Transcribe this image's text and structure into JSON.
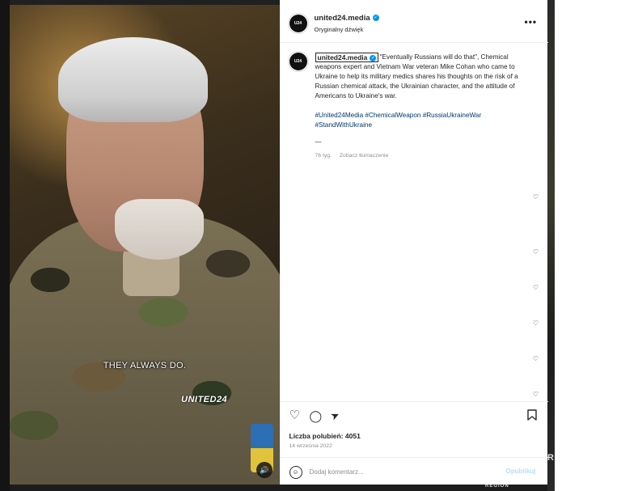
{
  "background": {
    "right_text_1": "R",
    "right_text_2": "REGION"
  },
  "video": {
    "subtitle": "THEY ALWAYS DO.",
    "watermark": "UNITED24",
    "audio_icon": "speaker-icon"
  },
  "header": {
    "username": "united24.media",
    "audio_label": "Oryginalny dźwięk",
    "avatar_text": "UNITED24 MEDIA",
    "more_icon": "•••"
  },
  "caption": {
    "username": "united24.media",
    "text": "\"Eventually Russians will do that\", Chemical weapons expert and Vietnam War veteran Mike Cohan who came to Ukraine to help its military medics shares his thoughts on the risk of a Russian chemical attack, the Ukrainian character, and the attitude of Americans to Ukraine's war.",
    "hashtags": "#United24Media #ChemicalWeapon #RussiaUkraineWar #StandWithUkraine",
    "separator": "—",
    "time_ago": "76 tyg.",
    "translate": "Zobacz tłumaczenie"
  },
  "comments": {
    "like_icon": "♡"
  },
  "actions": {
    "like_icon": "♡",
    "comment_icon": "◯",
    "share_icon": "➤",
    "save_icon": "🔖"
  },
  "likes": "Liczba polubień: 4051",
  "date": "14 września 2022",
  "comment_box": {
    "placeholder": "Dodaj komentarz...",
    "post_label": "Opublikuj",
    "emoji_icon": "☺"
  },
  "colors": {
    "link": "#00376b",
    "verified": "#0095f6",
    "muted": "#8e8e8e",
    "post_disabled": "#b2dffc"
  }
}
